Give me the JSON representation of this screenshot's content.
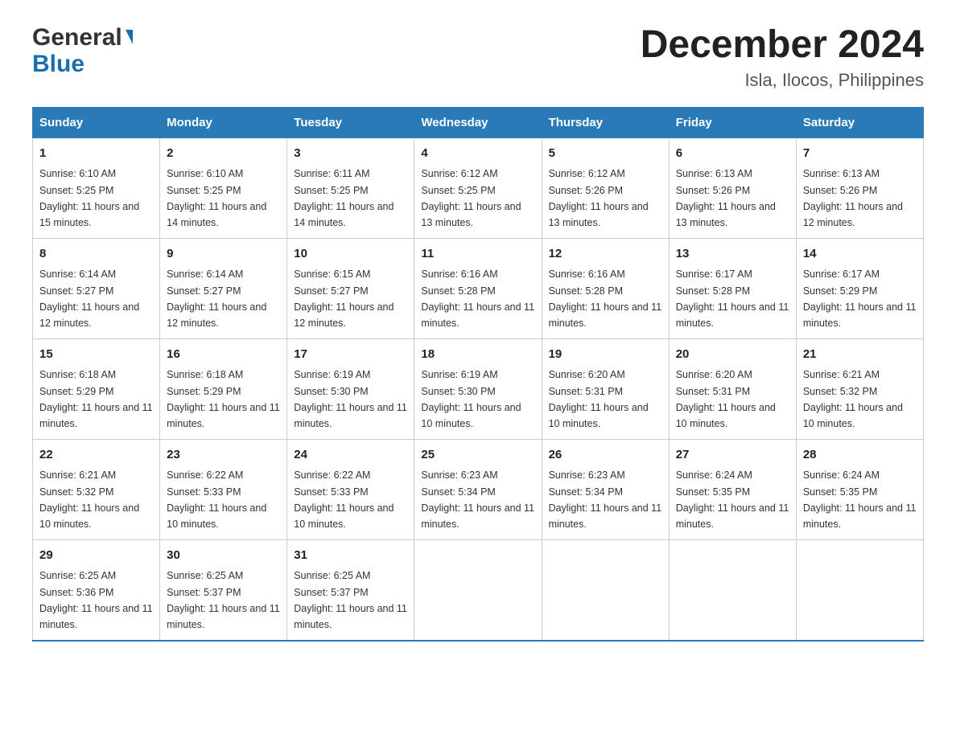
{
  "logo": {
    "general": "General",
    "blue": "Blue"
  },
  "title": {
    "month_year": "December 2024",
    "location": "Isla, Ilocos, Philippines"
  },
  "days_header": [
    "Sunday",
    "Monday",
    "Tuesday",
    "Wednesday",
    "Thursday",
    "Friday",
    "Saturday"
  ],
  "weeks": [
    [
      {
        "day": "1",
        "sunrise": "6:10 AM",
        "sunset": "5:25 PM",
        "daylight": "11 hours and 15 minutes."
      },
      {
        "day": "2",
        "sunrise": "6:10 AM",
        "sunset": "5:25 PM",
        "daylight": "11 hours and 14 minutes."
      },
      {
        "day": "3",
        "sunrise": "6:11 AM",
        "sunset": "5:25 PM",
        "daylight": "11 hours and 14 minutes."
      },
      {
        "day": "4",
        "sunrise": "6:12 AM",
        "sunset": "5:25 PM",
        "daylight": "11 hours and 13 minutes."
      },
      {
        "day": "5",
        "sunrise": "6:12 AM",
        "sunset": "5:26 PM",
        "daylight": "11 hours and 13 minutes."
      },
      {
        "day": "6",
        "sunrise": "6:13 AM",
        "sunset": "5:26 PM",
        "daylight": "11 hours and 13 minutes."
      },
      {
        "day": "7",
        "sunrise": "6:13 AM",
        "sunset": "5:26 PM",
        "daylight": "11 hours and 12 minutes."
      }
    ],
    [
      {
        "day": "8",
        "sunrise": "6:14 AM",
        "sunset": "5:27 PM",
        "daylight": "11 hours and 12 minutes."
      },
      {
        "day": "9",
        "sunrise": "6:14 AM",
        "sunset": "5:27 PM",
        "daylight": "11 hours and 12 minutes."
      },
      {
        "day": "10",
        "sunrise": "6:15 AM",
        "sunset": "5:27 PM",
        "daylight": "11 hours and 12 minutes."
      },
      {
        "day": "11",
        "sunrise": "6:16 AM",
        "sunset": "5:28 PM",
        "daylight": "11 hours and 11 minutes."
      },
      {
        "day": "12",
        "sunrise": "6:16 AM",
        "sunset": "5:28 PM",
        "daylight": "11 hours and 11 minutes."
      },
      {
        "day": "13",
        "sunrise": "6:17 AM",
        "sunset": "5:28 PM",
        "daylight": "11 hours and 11 minutes."
      },
      {
        "day": "14",
        "sunrise": "6:17 AM",
        "sunset": "5:29 PM",
        "daylight": "11 hours and 11 minutes."
      }
    ],
    [
      {
        "day": "15",
        "sunrise": "6:18 AM",
        "sunset": "5:29 PM",
        "daylight": "11 hours and 11 minutes."
      },
      {
        "day": "16",
        "sunrise": "6:18 AM",
        "sunset": "5:29 PM",
        "daylight": "11 hours and 11 minutes."
      },
      {
        "day": "17",
        "sunrise": "6:19 AM",
        "sunset": "5:30 PM",
        "daylight": "11 hours and 11 minutes."
      },
      {
        "day": "18",
        "sunrise": "6:19 AM",
        "sunset": "5:30 PM",
        "daylight": "11 hours and 10 minutes."
      },
      {
        "day": "19",
        "sunrise": "6:20 AM",
        "sunset": "5:31 PM",
        "daylight": "11 hours and 10 minutes."
      },
      {
        "day": "20",
        "sunrise": "6:20 AM",
        "sunset": "5:31 PM",
        "daylight": "11 hours and 10 minutes."
      },
      {
        "day": "21",
        "sunrise": "6:21 AM",
        "sunset": "5:32 PM",
        "daylight": "11 hours and 10 minutes."
      }
    ],
    [
      {
        "day": "22",
        "sunrise": "6:21 AM",
        "sunset": "5:32 PM",
        "daylight": "11 hours and 10 minutes."
      },
      {
        "day": "23",
        "sunrise": "6:22 AM",
        "sunset": "5:33 PM",
        "daylight": "11 hours and 10 minutes."
      },
      {
        "day": "24",
        "sunrise": "6:22 AM",
        "sunset": "5:33 PM",
        "daylight": "11 hours and 10 minutes."
      },
      {
        "day": "25",
        "sunrise": "6:23 AM",
        "sunset": "5:34 PM",
        "daylight": "11 hours and 11 minutes."
      },
      {
        "day": "26",
        "sunrise": "6:23 AM",
        "sunset": "5:34 PM",
        "daylight": "11 hours and 11 minutes."
      },
      {
        "day": "27",
        "sunrise": "6:24 AM",
        "sunset": "5:35 PM",
        "daylight": "11 hours and 11 minutes."
      },
      {
        "day": "28",
        "sunrise": "6:24 AM",
        "sunset": "5:35 PM",
        "daylight": "11 hours and 11 minutes."
      }
    ],
    [
      {
        "day": "29",
        "sunrise": "6:25 AM",
        "sunset": "5:36 PM",
        "daylight": "11 hours and 11 minutes."
      },
      {
        "day": "30",
        "sunrise": "6:25 AM",
        "sunset": "5:37 PM",
        "daylight": "11 hours and 11 minutes."
      },
      {
        "day": "31",
        "sunrise": "6:25 AM",
        "sunset": "5:37 PM",
        "daylight": "11 hours and 11 minutes."
      },
      {
        "day": "",
        "sunrise": "",
        "sunset": "",
        "daylight": ""
      },
      {
        "day": "",
        "sunrise": "",
        "sunset": "",
        "daylight": ""
      },
      {
        "day": "",
        "sunrise": "",
        "sunset": "",
        "daylight": ""
      },
      {
        "day": "",
        "sunrise": "",
        "sunset": "",
        "daylight": ""
      }
    ]
  ],
  "labels": {
    "sunrise_prefix": "Sunrise: ",
    "sunset_prefix": "Sunset: ",
    "daylight_prefix": "Daylight: "
  }
}
